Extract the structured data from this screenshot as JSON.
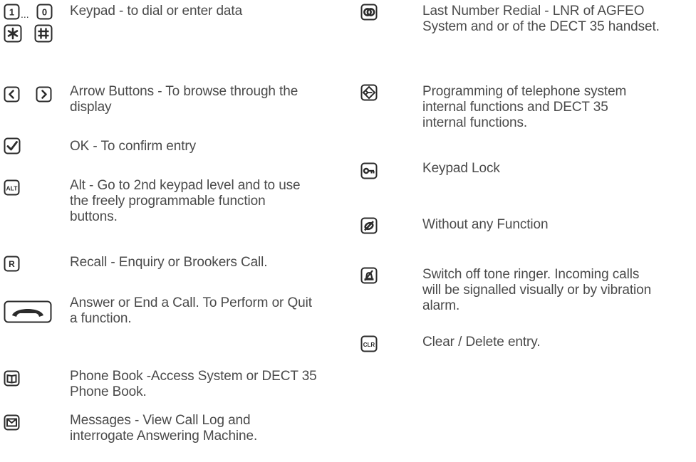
{
  "keys": {
    "key_1": "1",
    "key_0": "0",
    "ellipsis": "...",
    "key_star": "✱",
    "key_hash": "♯",
    "alt_key": "ALT",
    "recall_key": "R",
    "clear_key": "CLR"
  },
  "left": [
    {
      "id": "keypad",
      "text": "Keypad - to dial or enter data"
    },
    {
      "id": "arrows",
      "text": "Arrow Buttons - To browse through the\ndisplay"
    },
    {
      "id": "ok",
      "text": "OK - To confirm entry"
    },
    {
      "id": "alt",
      "text": "Alt - Go to 2nd keypad level and to use\nthe freely programmable function\nbuttons."
    },
    {
      "id": "recall",
      "text": "Recall - Enquiry or Brookers Call."
    },
    {
      "id": "answer",
      "text": "Answer or End a Call. To Perform or Quit\na function."
    },
    {
      "id": "phonebook",
      "text": "Phone Book -Access System or DECT 35\nPhone Book."
    },
    {
      "id": "messages",
      "text": "Messages - View Call Log and\ninterrogate Answering Machine."
    }
  ],
  "right": [
    {
      "id": "redial",
      "text": "Last Number Redial - LNR of AGFEO\nSystem and or of the DECT 35 handset."
    },
    {
      "id": "programming",
      "text": "Programming of telephone system\ninternal functions and DECT 35\ninternal functions."
    },
    {
      "id": "keylock",
      "text": "Keypad Lock"
    },
    {
      "id": "nofunction",
      "text": "Without any Function"
    },
    {
      "id": "ringeroff",
      "text": "Switch off tone ringer. Incoming calls\nwill be signalled visually or by vibration\nalarm."
    },
    {
      "id": "clear",
      "text": "Clear / Delete entry."
    }
  ],
  "colors": {
    "text": "#4a4a4a",
    "icon": "#2b2b2b"
  }
}
